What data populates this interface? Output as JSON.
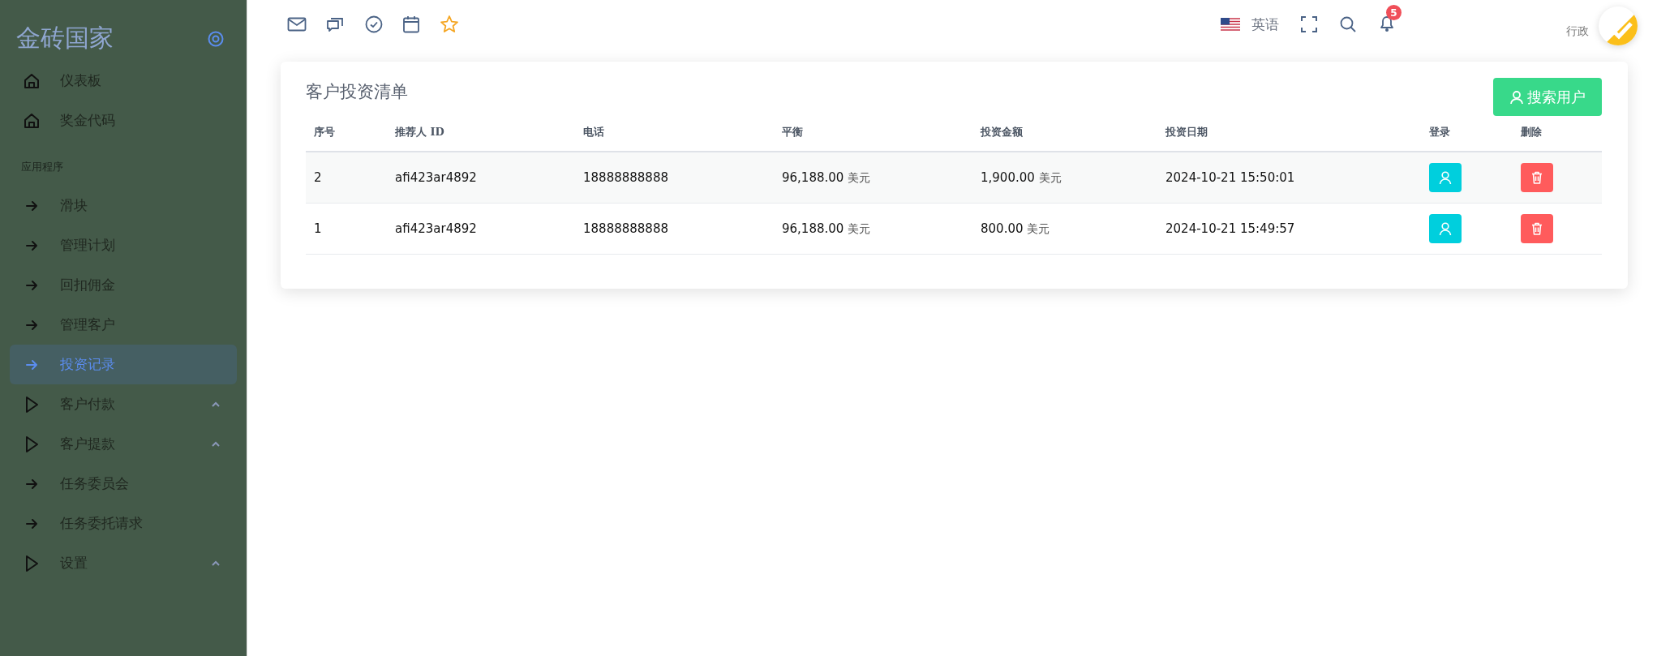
{
  "sidebar": {
    "logo": "金砖国家",
    "items": [
      {
        "kind": "home",
        "label": "仪表板",
        "selected": false
      },
      {
        "kind": "home",
        "label": "奖金代码",
        "selected": false
      },
      {
        "kind": "section",
        "label": "应用程序"
      },
      {
        "kind": "arrow",
        "label": "滑块",
        "selected": false
      },
      {
        "kind": "arrow",
        "label": "管理计划",
        "selected": false
      },
      {
        "kind": "arrow",
        "label": "回扣佣金",
        "selected": false
      },
      {
        "kind": "arrow",
        "label": "管理客户",
        "selected": false
      },
      {
        "kind": "arrow",
        "label": "投资记录",
        "selected": true
      },
      {
        "kind": "group",
        "label": "客户付款",
        "selected": false
      },
      {
        "kind": "group",
        "label": "客户提款",
        "selected": false
      },
      {
        "kind": "arrow",
        "label": "任务委员会",
        "selected": false
      },
      {
        "kind": "arrow",
        "label": "任务委托请求",
        "selected": false
      },
      {
        "kind": "group",
        "label": "设置",
        "selected": false
      }
    ]
  },
  "topbar": {
    "shortcuts": [
      {
        "kind": "mail"
      },
      {
        "kind": "chat"
      },
      {
        "kind": "check"
      },
      {
        "kind": "calendar"
      },
      {
        "kind": "star"
      }
    ],
    "language": "英语",
    "notification_count": "5",
    "user": "行政"
  },
  "card": {
    "title": "客户投资清单",
    "button": "搜索用户",
    "table": {
      "columns": [
        "序号",
        "推荐人 ID",
        "电话",
        "平衡",
        "投资金额",
        "投资日期",
        "登录",
        "删除"
      ],
      "rows": [
        {
          "no": "2",
          "referrer_id": "afi423ar4892",
          "phone": "18888888888",
          "balance": "96,188.00",
          "balance_unit": "美元",
          "amount": "1,900.00",
          "amount_unit": "美元",
          "date": "2024-10-21 15:50:01"
        },
        {
          "no": "1",
          "referrer_id": "afi423ar4892",
          "phone": "18888888888",
          "balance": "96,188.00",
          "balance_unit": "美元",
          "amount": "800.00",
          "amount_unit": "美元",
          "date": "2024-10-21 15:49:57"
        }
      ]
    }
  }
}
